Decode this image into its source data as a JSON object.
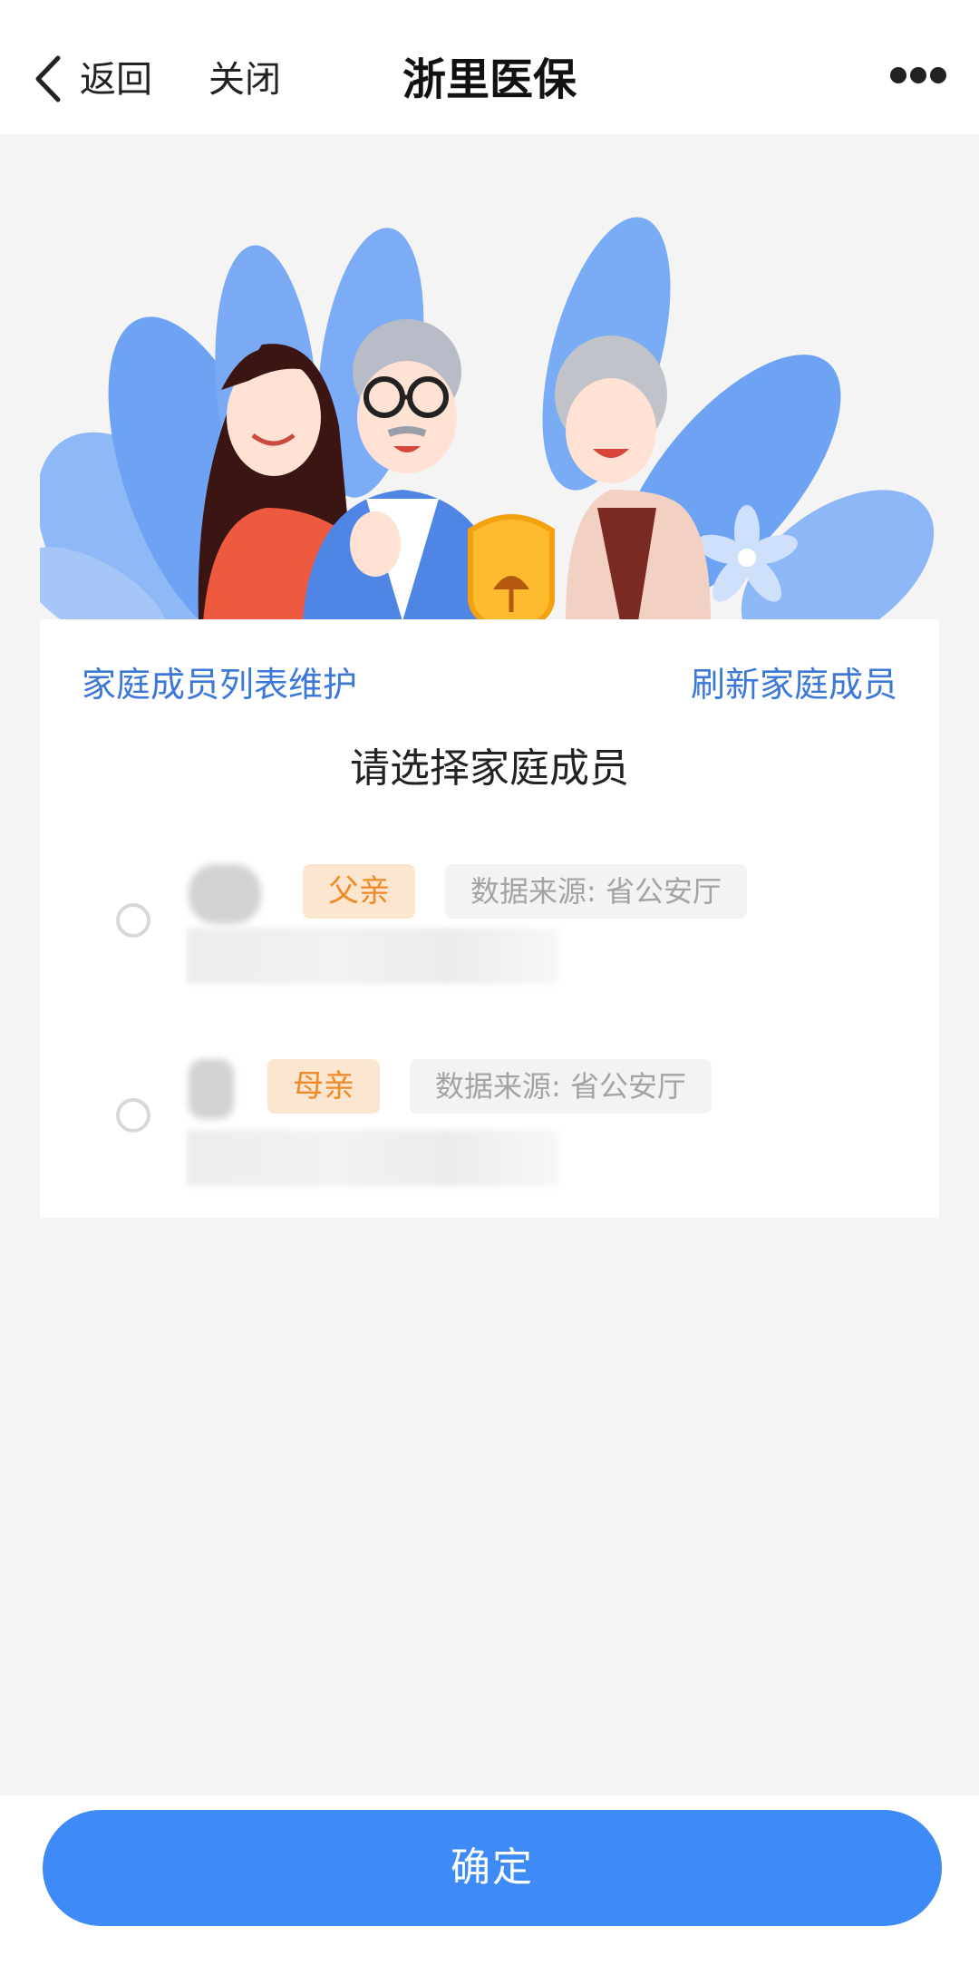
{
  "nav": {
    "back_label": "返回",
    "close_label": "关闭",
    "title": "浙里医保"
  },
  "card": {
    "maintain_link": "家庭成员列表维护",
    "refresh_link": "刷新家庭成员",
    "title": "请选择家庭成员"
  },
  "members": [
    {
      "relation": "父亲",
      "source": "数据来源: 省公安厅"
    },
    {
      "relation": "母亲",
      "source": "数据来源: 省公安厅"
    }
  ],
  "confirm_label": "确定",
  "colors": {
    "accent": "#3e8af7",
    "link": "#3c78d8",
    "relation_tag_bg": "#fde6cf",
    "relation_tag_text": "#ee8a28"
  }
}
